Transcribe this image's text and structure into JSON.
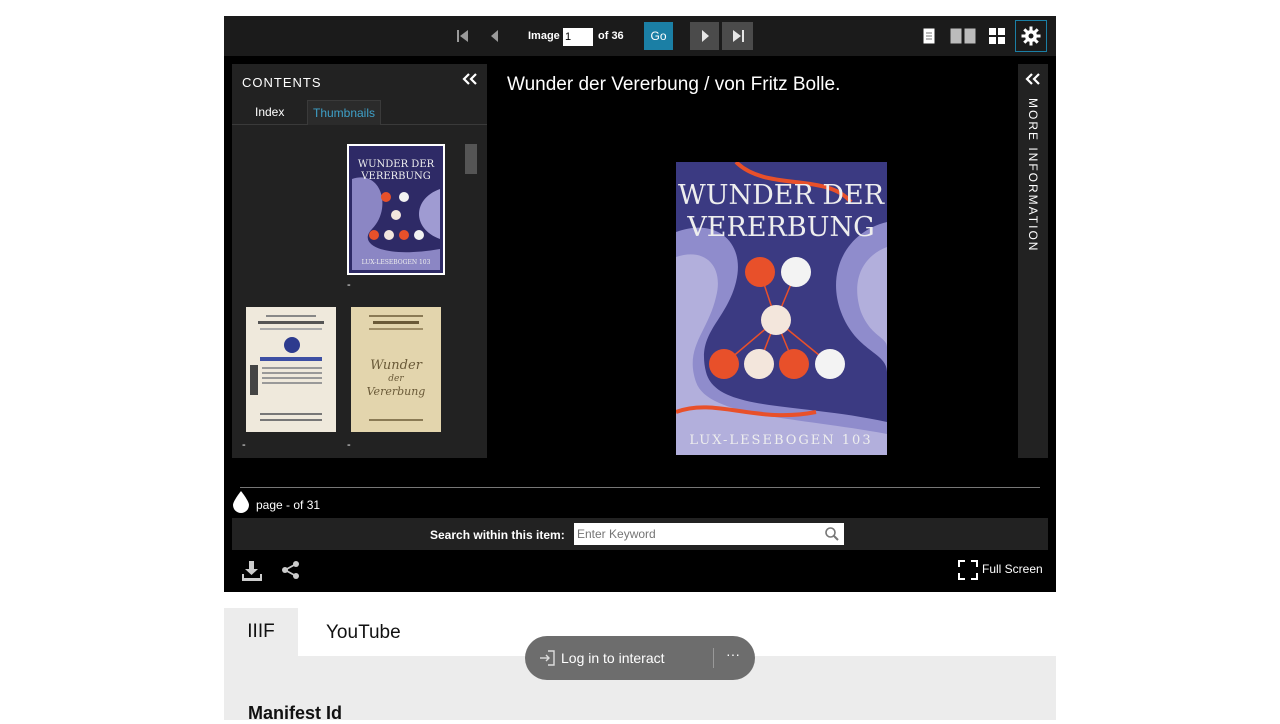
{
  "toolbar": {
    "image_label": "Image",
    "image_value": "1",
    "of_label": "of 36",
    "go_label": "Go"
  },
  "contents": {
    "title": "CONTENTS",
    "tabs": [
      {
        "label": "Index"
      },
      {
        "label": "Thumbnails"
      }
    ],
    "thumbnails": [
      {
        "caption": "-"
      },
      {
        "caption": "-"
      },
      {
        "caption": "-"
      }
    ]
  },
  "viewer": {
    "title": "Wunder der Vererbung / von Fritz Bolle.",
    "cover_title_1": "WUNDER DER",
    "cover_title_2": "VERERBUNG",
    "cover_series": "LUX-LESEBOGEN 103",
    "more_info_label": "MORE INFORMATION"
  },
  "page_slider": {
    "label": "page - of 31"
  },
  "search": {
    "label": "Search within this item:",
    "placeholder": "Enter Keyword"
  },
  "bottom": {
    "fullscreen_label": "Full Screen"
  },
  "lower_tabs": [
    {
      "label": "IIIF"
    },
    {
      "label": "YouTube"
    }
  ],
  "lower_content": {
    "heading": "Manifest Id"
  },
  "login_pill": {
    "label": "Log in to interact",
    "more": "···"
  },
  "colors": {
    "accent": "#1b7fa5",
    "viewer_bg": "#000000",
    "panel_bg": "#222222",
    "cover_blue": "#2e2a66",
    "cover_orange": "#e8502a"
  }
}
